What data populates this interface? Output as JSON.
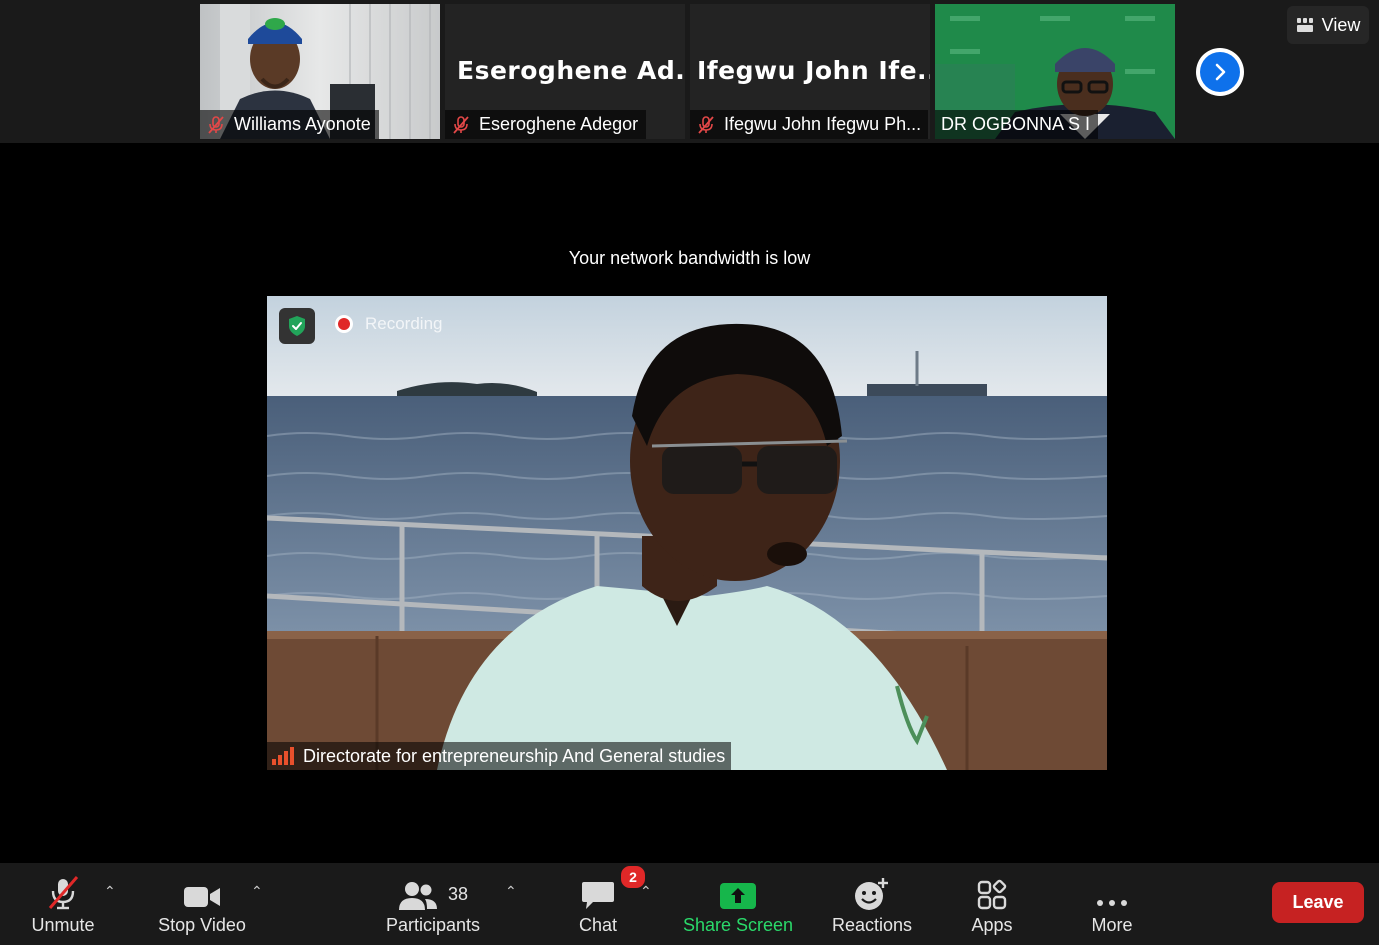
{
  "view_button": {
    "label": "View"
  },
  "participants_strip": [
    {
      "name": "Williams Ayonote"
    },
    {
      "name": "Eseroghene Adegor",
      "display_name": "Eseroghene  Ad..."
    },
    {
      "name": "Ifegwu John Ifegwu Ph...",
      "display_name": "Ifegwu  John  Ife..."
    },
    {
      "name": "DR OGBONNA S I"
    }
  ],
  "notice": "Your network bandwidth is low",
  "main_video": {
    "recording_label": "Recording",
    "speaker_name": "Directorate for entrepreneurship And General studies"
  },
  "toolbar": {
    "unmute": "Unmute",
    "stop_video": "Stop Video",
    "participants": "Participants",
    "participants_count": "38",
    "chat": "Chat",
    "chat_badge": "2",
    "share_screen": "Share Screen",
    "reactions": "Reactions",
    "apps": "Apps",
    "more": "More",
    "leave": "Leave"
  },
  "colors": {
    "accent_blue": "#0e71eb",
    "share_green": "#16b64b",
    "leave_red": "#c62222",
    "recording_red": "#e02828"
  }
}
